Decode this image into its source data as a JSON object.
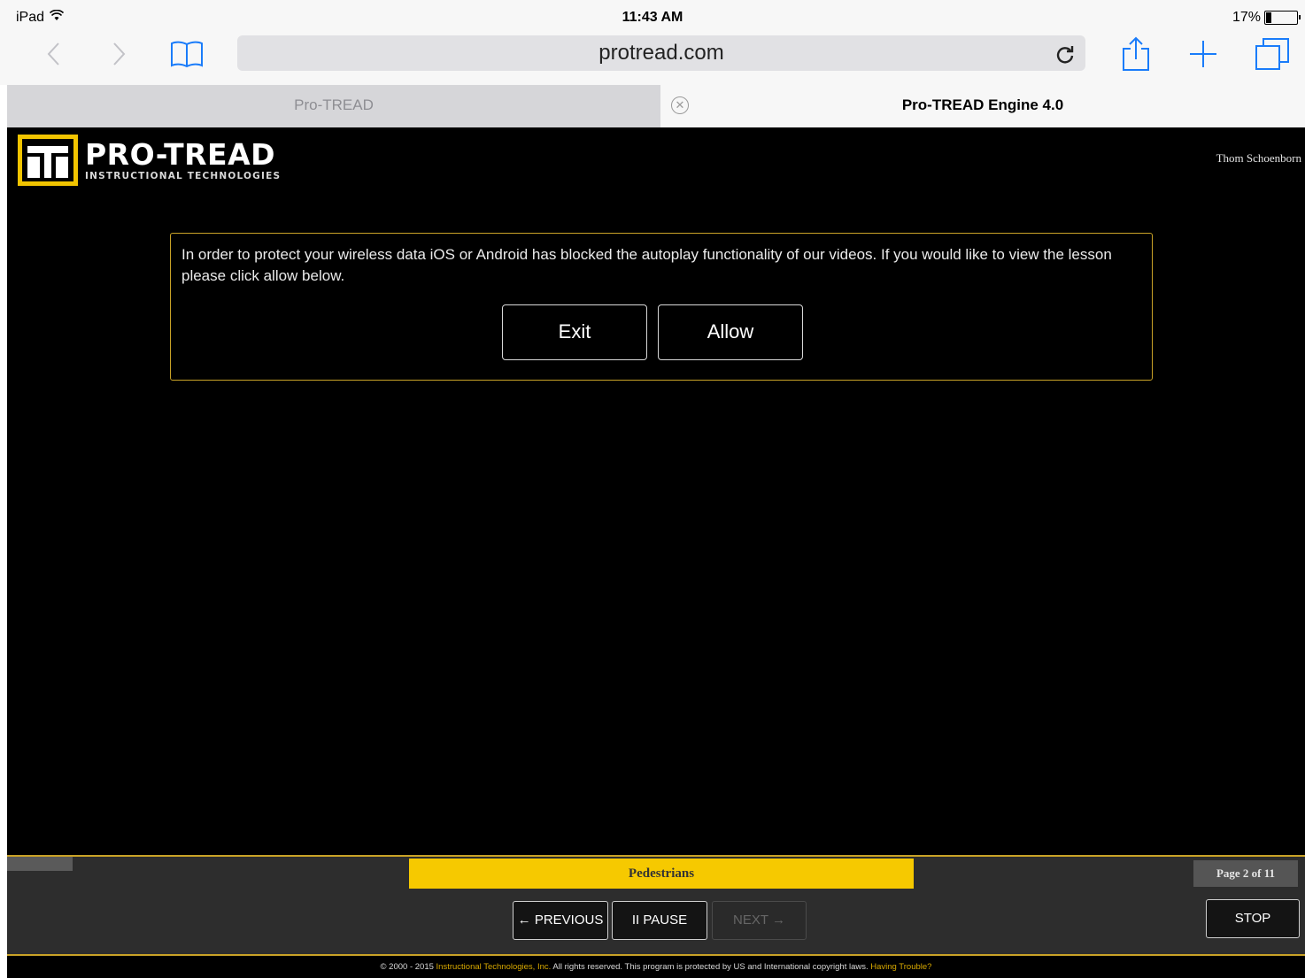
{
  "status_bar": {
    "device": "iPad",
    "time": "11:43 AM",
    "battery": "17%"
  },
  "browser": {
    "url": "protread.com",
    "tabs": [
      {
        "label": "Pro-TREAD"
      },
      {
        "label": "Pro-TREAD Engine 4.0"
      }
    ]
  },
  "app": {
    "logo_name": "PRO-TREAD",
    "logo_subtitle": "INSTRUCTIONAL TECHNOLOGIES",
    "user_name": "Thom Schoenborn",
    "dialog": {
      "message": "In order to protect your wireless data iOS or Android has blocked the autoplay functionality of our videos. If you would like to view the lesson please click allow below.",
      "exit_label": "Exit",
      "allow_label": "Allow"
    },
    "lesson_title": "Pedestrians",
    "page_indicator": "Page 2 of 11",
    "controls": {
      "previous": "← PREVIOUS",
      "pause": "II PAUSE",
      "next": "NEXT →",
      "stop": "STOP"
    },
    "footer": {
      "copyright_prefix": "© 2000 - 2015 ",
      "company_link": "Instructional Technologies, Inc.",
      "rights_text": " All rights reserved. This program is protected by US and International copyright laws. ",
      "trouble_link": "Having Trouble?"
    }
  },
  "colors": {
    "accent_gold": "#f6c900",
    "border_gold": "#c9a227",
    "ios_blue": "#1a7cfa"
  }
}
